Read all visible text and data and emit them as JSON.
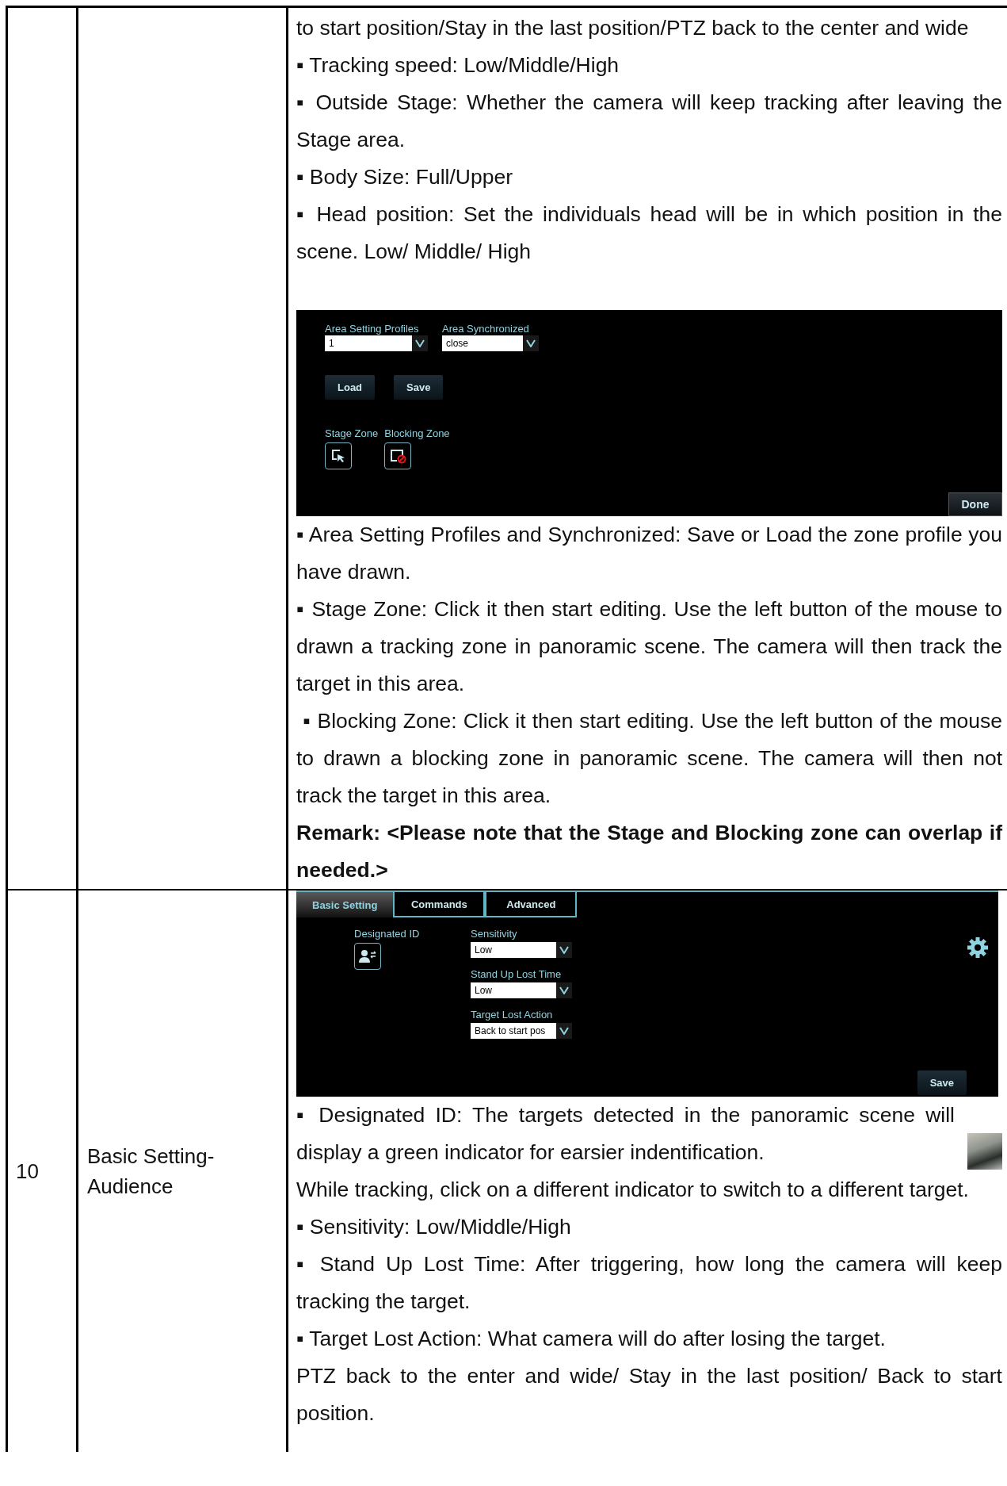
{
  "rows": [
    {
      "content": [
        {
          "kind": "text",
          "text": "to start position/Stay in the last position/PTZ back to the center and wide"
        },
        {
          "kind": "text",
          "text": "▪ Tracking speed: Low/Middle/High"
        },
        {
          "kind": "text",
          "text": "▪ Outside Stage: Whether the camera will keep tracking after leaving the Stage area."
        },
        {
          "kind": "text",
          "text": "▪ Body Size: Full/Upper"
        },
        {
          "kind": "text",
          "text": "▪ Head position: Set the individuals head will be in which position in the scene. Low/ Middle/ High"
        },
        {
          "kind": "area_panel",
          "dropdowns": [
            {
              "label": "Area Setting Profiles",
              "value": "1"
            },
            {
              "label": "Area Synchronized",
              "value": "close"
            }
          ],
          "buttons": [
            "Load",
            "Save"
          ],
          "zones": [
            {
              "label": "Stage Zone",
              "kind": "stage"
            },
            {
              "label": "Blocking Zone",
              "kind": "blocking"
            }
          ],
          "done": "Done"
        },
        {
          "kind": "text",
          "text": "▪ Area Setting Profiles and Synchronized: Save or Load the zone profile you have drawn."
        },
        {
          "kind": "text",
          "text": "▪ Stage Zone: Click it then start editing. Use the left button of the mouse to drawn a tracking zone in panoramic scene. The camera will then track the target in this area."
        },
        {
          "kind": "text",
          "text": " ▪ Blocking Zone: Click it then start editing. Use the left button of the mouse to drawn a blocking zone in panoramic scene. The camera will then not track the target in this area."
        },
        {
          "kind": "remark",
          "text": "Remark: <Please note that the Stage and Blocking zone can overlap if needed.>"
        }
      ]
    },
    {
      "number": "10",
      "title": "Basic Setting-Audience",
      "content": [
        {
          "kind": "settings_panel",
          "tabs": [
            {
              "label": "Basic Setting",
              "selected": true
            },
            {
              "label": "Commands",
              "selected": false
            },
            {
              "label": "Advanced",
              "selected": false
            }
          ],
          "designated_label": "Designated ID",
          "dropdowns": [
            {
              "label": "Sensitivity",
              "value": "Low"
            },
            {
              "label": "Stand Up Lost Time",
              "value": "Low"
            },
            {
              "label": "Target Lost Action",
              "value": "Back to start pos"
            }
          ],
          "save": "Save"
        },
        {
          "kind": "text_photo",
          "text": "▪ Designated ID: The targets detected in the panoramic scene will display a green indicator for earsier indentification."
        },
        {
          "kind": "text",
          "text": "While tracking, click on a different indicator to switch to a different target."
        },
        {
          "kind": "text",
          "text": "▪ Sensitivity: Low/Middle/High"
        },
        {
          "kind": "text",
          "text": "▪ Stand Up Lost Time: After triggering, how long the camera will keep tracking the target."
        },
        {
          "kind": "text",
          "text": "▪ Target Lost Action: What camera will do after losing the target."
        },
        {
          "kind": "text",
          "text": "PTZ back to the enter and wide/ Stay in the last position/ Back to start position."
        }
      ]
    }
  ]
}
